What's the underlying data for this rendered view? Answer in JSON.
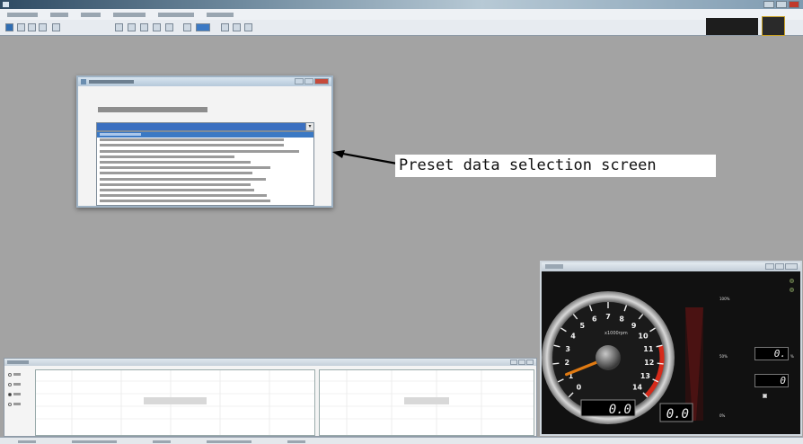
{
  "callout": {
    "label": "Preset data selection screen"
  },
  "gauge": {
    "scale": [
      0,
      1,
      2,
      3,
      4,
      5,
      6,
      7,
      8,
      9,
      10,
      11,
      12,
      13,
      14
    ],
    "redline_from": 11,
    "needle_value": 1.2,
    "readout_main": "0.0",
    "readout_small": "0.0",
    "readout_mid": "0.",
    "readout_right": "0",
    "bar_pct_top": "100%",
    "bar_pct_mid": "50%",
    "bar_pct_bottom": "0%"
  },
  "colors": {
    "accent": "#3b79c4",
    "gauge_redline": "#d62a1a",
    "needle": "#e07a12",
    "callout_bg": "#ffffff"
  },
  "icons": [
    "window-icon",
    "save-icon",
    "open-icon",
    "play-icon",
    "stop-icon",
    "arrow-left-icon"
  ]
}
